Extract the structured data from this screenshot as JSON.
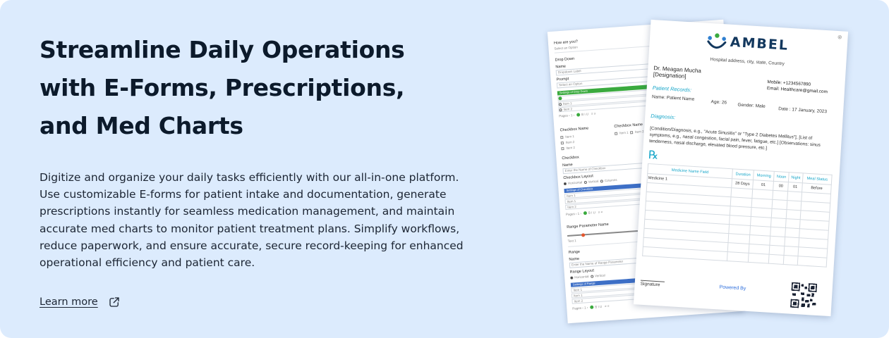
{
  "hero": {
    "headline": [
      "Streamline Daily Operations",
      "with E-Forms, Prescriptions,",
      "and Med Charts"
    ],
    "description": "Digitize and organize your daily tasks efficiently with our all-in-one platform. Use customizable E-forms for patient intake and documentation, generate prescriptions instantly for seamless medication management, and maintain accurate med charts to monitor patient treatment plans. Simplify workflows, reduce paperwork, and ensure accurate, secure record-keeping for enhanced operational efficiency and patient care.",
    "learn_more": "Learn more",
    "learn_more_icon": "external-link-icon"
  },
  "colors": {
    "background": "#dcebfd",
    "headline": "#0c1a2b",
    "accent_teal": "#17a6c9",
    "accent_green": "#3aaa3e",
    "accent_blue": "#3d6fc6"
  },
  "form_sheet": {
    "question": "How are you?",
    "select_option": "Select an Option",
    "drop_down": "Drop Down",
    "name": "Name",
    "name_placeholder": "Dropdown Label",
    "prompt": "Prompt",
    "prompt_placeholder": "Select an Option",
    "settings_drop_down": "Settings of Drop Down",
    "item1": "Item 1",
    "item2": "Item 2",
    "pagination": "Pages",
    "checkbox_name": "Checkbox Name",
    "checkbox": "Checkbox",
    "checkbox_placeholder": "Enter the Name of Checkbox",
    "checkbox_layout": "Checkbox Layout",
    "horizontal": "Horizontal",
    "vertical": "Vertical",
    "columns": "Columns",
    "settings_checkbox": "Settings of Checkbox",
    "range_parameter_name": "Range Parameter Name",
    "text1": "Text 1",
    "range": "Range",
    "range_placeholder": "Enter the Name of Range Parameter",
    "range_layout": "Range Layout",
    "settings_range": "Settings of Range"
  },
  "prescription": {
    "brand": "AMBEL",
    "brand_icon": "ambel-people-logo-icon",
    "close_icon": "close-icon",
    "address": "Hospital address, city, state, Country",
    "doctor": "Dr. Meagan Mucha",
    "designation": "[Designation]",
    "mobile": "Mobile: +1234567890",
    "email": "Email: Healthcare@gmail.com",
    "patient_records_label": "Patient Records:",
    "patient_name": "Name:  Patient Name",
    "age": "Age: 26",
    "gender": "Gender: Male",
    "date": "Date : 17 January, 2023",
    "diagnosis_label": "Diagnosis:",
    "diagnosis_text": "[Condition/Diagnosis, e.g., \"Acute Sinusitis\" or \"Type 2 Diabetes Mellitus\"],  [List of symptoms, e.g., nasal congestion, facial pain, fever, fatigue, etc.] [Observations: sinus tenderness, nasal discharge, elevated blood pressure, etc.]",
    "rx_symbol": "℞",
    "table_headers": [
      "Medicine Name Field",
      "Duration",
      "Morning",
      "Noon",
      "Night",
      "Meal Status"
    ],
    "table_row": [
      "Medicine 1",
      "28 Days",
      "01",
      "00",
      "01",
      "Before"
    ],
    "signature": "Signature",
    "powered_by": "Powered By",
    "qr_icon": "qr-code-icon"
  }
}
